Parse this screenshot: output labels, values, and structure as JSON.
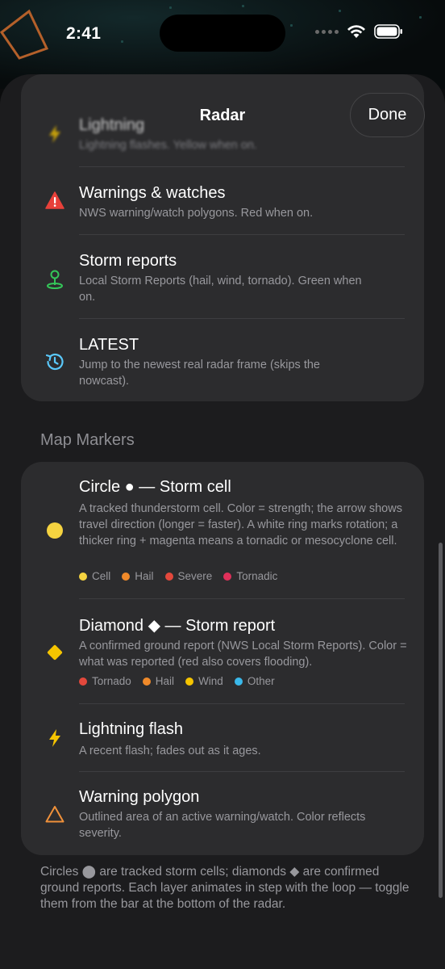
{
  "status": {
    "time": "2:41"
  },
  "nav": {
    "title": "Radar",
    "done_label": "Done"
  },
  "layers": [
    {
      "title": "Lightning",
      "subtitle": "Lightning flashes. Yellow when on.",
      "icon": "lightning-icon",
      "color": "#f5c400"
    },
    {
      "title": "Warnings & watches",
      "subtitle": "NWS warning/watch polygons. Red when on.",
      "icon": "warning-triangle-icon",
      "color": "#e8413a"
    },
    {
      "title": "Storm reports",
      "subtitle": "Local Storm Reports (hail, wind, tornado). Green when on.",
      "icon": "map-pin-icon",
      "color": "#34c759"
    },
    {
      "title": "LATEST",
      "subtitle": "Jump to the newest real radar frame (skips the nowcast).",
      "icon": "clock-history-icon",
      "color": "#5ac8fa"
    }
  ],
  "markers_section": {
    "header": "Map Markers"
  },
  "markers": [
    {
      "title": "Circle ● — Storm cell",
      "subtitle": "A tracked thunderstorm cell. Color = strength; the arrow shows travel direction (longer = faster). A white ring marks rotation; a thicker ring + magenta means a tornadic or mesocyclone cell.",
      "icon": "circle-icon",
      "color": "#f5d340",
      "legend": [
        {
          "label": "Cell",
          "color": "#f5d340"
        },
        {
          "label": "Hail",
          "color": "#f08a2a"
        },
        {
          "label": "Severe",
          "color": "#e3483c"
        },
        {
          "label": "Tornadic",
          "color": "#e0305a"
        }
      ]
    },
    {
      "title": "Diamond ◆ — Storm report",
      "subtitle": "A confirmed ground report (NWS Local Storm Reports). Color = what was reported (red also covers flooding).",
      "icon": "diamond-icon",
      "color": "#f5c400",
      "legend": [
        {
          "label": "Tornado",
          "color": "#e3483c"
        },
        {
          "label": "Hail",
          "color": "#f08a2a"
        },
        {
          "label": "Wind",
          "color": "#f5c400"
        },
        {
          "label": "Other",
          "color": "#3ab8ea"
        }
      ]
    },
    {
      "title": "Lightning flash",
      "subtitle": "A recent flash; fades out as it ages.",
      "icon": "lightning-icon",
      "color": "#f5c400"
    },
    {
      "title": "Warning polygon",
      "subtitle": "Outlined area of an active warning/watch. Color reflects severity.",
      "icon": "triangle-outline-icon",
      "color": "#f0913a"
    }
  ],
  "footer_note": "Circles ⬤ are tracked storm cells; diamonds ◆ are confirmed ground reports. Each layer animates in step with the loop — toggle them from the bar at the bottom of the radar."
}
